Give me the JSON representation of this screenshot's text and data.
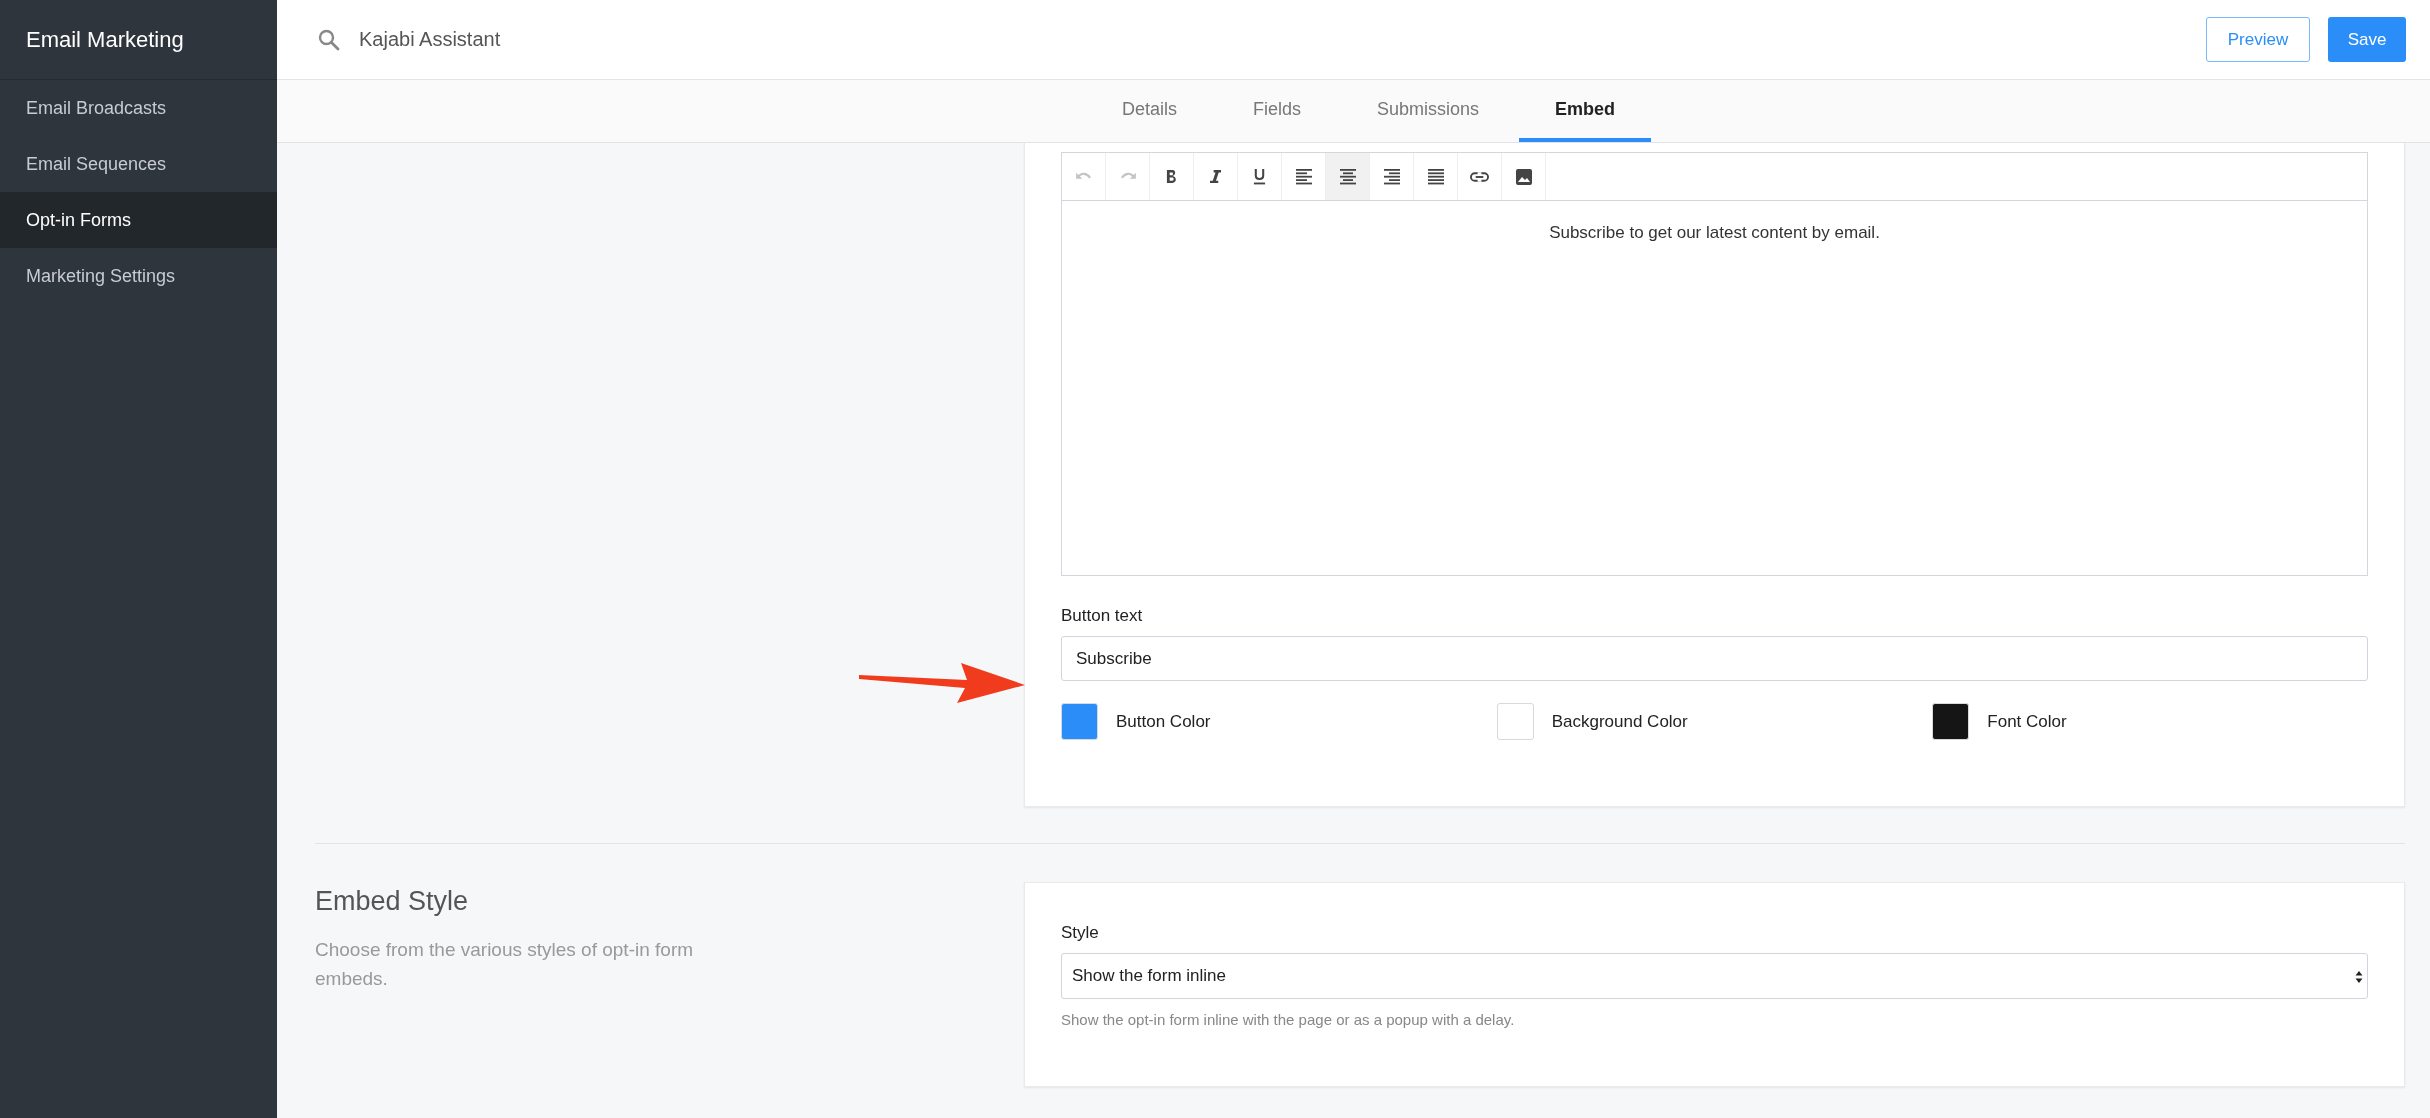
{
  "sidebar": {
    "title": "Email Marketing",
    "items": [
      {
        "label": "Email Broadcasts",
        "selected": false
      },
      {
        "label": "Email Sequences",
        "selected": false
      },
      {
        "label": "Opt-in Forms",
        "selected": true
      },
      {
        "label": "Marketing Settings",
        "selected": false
      }
    ]
  },
  "topbar": {
    "search": {
      "value": "Kajabi Assistant"
    },
    "buttons": [
      {
        "label": "Preview",
        "kind": "outline"
      },
      {
        "label": "Save",
        "kind": "primary"
      }
    ]
  },
  "tabs": [
    {
      "label": "Details",
      "selected": false
    },
    {
      "label": "Fields",
      "selected": false
    },
    {
      "label": "Submissions",
      "selected": false
    },
    {
      "label": "Embed",
      "selected": true
    }
  ],
  "editor": {
    "toolbar": [
      {
        "kind": "undo",
        "disabled": true,
        "selected": false
      },
      {
        "kind": "redo",
        "disabled": true,
        "selected": false
      },
      {
        "kind": "bold",
        "disabled": false,
        "selected": false
      },
      {
        "kind": "italic",
        "disabled": false,
        "selected": false
      },
      {
        "kind": "underline",
        "disabled": false,
        "selected": false
      },
      {
        "kind": "align-left",
        "disabled": false,
        "selected": false
      },
      {
        "kind": "align-center",
        "disabled": false,
        "selected": true
      },
      {
        "kind": "align-right",
        "disabled": false,
        "selected": false
      },
      {
        "kind": "justify",
        "disabled": false,
        "selected": false
      },
      {
        "kind": "link",
        "disabled": false,
        "selected": false
      },
      {
        "kind": "image",
        "disabled": false,
        "selected": false
      }
    ],
    "content": "Subscribe to get our latest content by email."
  },
  "button_text": {
    "label": "Button text",
    "value": "Subscribe"
  },
  "colors": [
    {
      "label": "Button Color",
      "color": "#2b8ef8"
    },
    {
      "label": "Background Color",
      "color": "#ffffff"
    },
    {
      "label": "Font Color",
      "color": "#151515"
    }
  ],
  "embed_style": {
    "title": "Embed Style",
    "description": "Choose from the various styles of opt-in form embeds.",
    "field_label": "Style",
    "value": "Show the form inline",
    "help": "Show the opt-in form inline with the page or as a popup with a delay."
  }
}
